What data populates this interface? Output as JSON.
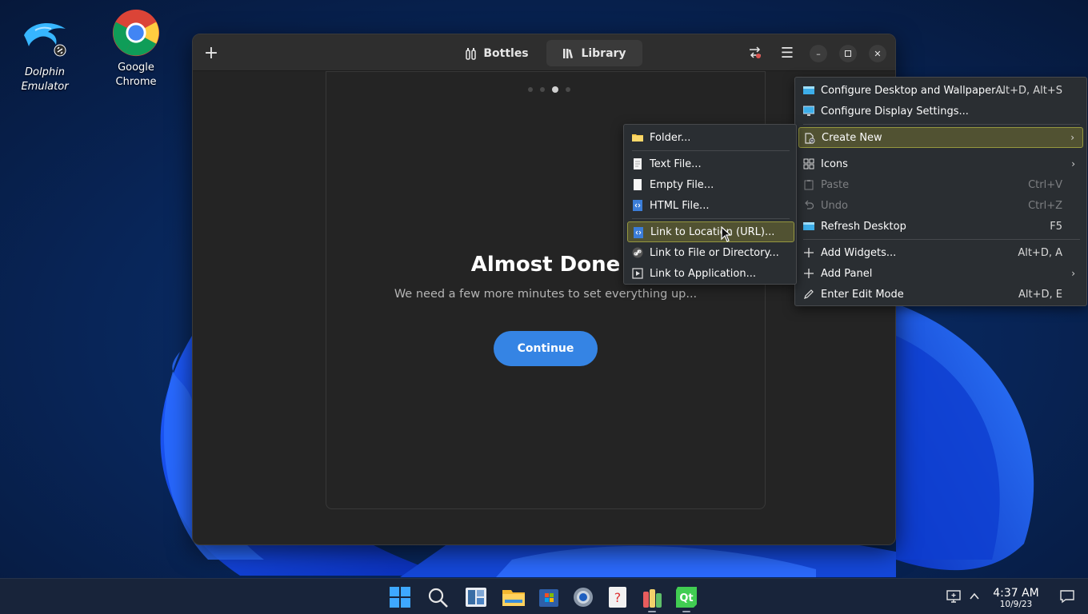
{
  "desktop": {
    "icons": [
      {
        "name": "Dolphin Emulator",
        "line1": "Dolphin",
        "line2": "Emulator",
        "icon": "dolphin-icon"
      },
      {
        "name": "Google Chrome",
        "line1": "Google Chrome",
        "icon": "chrome-icon"
      }
    ]
  },
  "app": {
    "tabs": [
      {
        "label": "Bottles",
        "icon": "bottles-icon"
      },
      {
        "label": "Library",
        "icon": "library-icon",
        "active": true
      }
    ],
    "onboarding": {
      "title": "Almost Done",
      "subtitle": "We need a few more minutes to set everything up...",
      "continue_label": "Continue",
      "page": 3,
      "page_count": 4
    }
  },
  "desktop_menu": {
    "items": [
      {
        "label": "Configure Desktop and Wallpaper...",
        "shortcut": "Alt+D, Alt+S",
        "icon": "wallpaper-icon"
      },
      {
        "label": "Configure Display Settings...",
        "shortcut": "",
        "icon": "display-icon"
      },
      {
        "label": "Create New",
        "shortcut": "",
        "icon": "create-new-icon",
        "submenu": true,
        "highlighted": true
      },
      {
        "label": "Icons",
        "shortcut": "",
        "icon": "grid-icon",
        "submenu": true
      },
      {
        "label": "Paste",
        "shortcut": "Ctrl+V",
        "icon": "paste-icon",
        "disabled": true
      },
      {
        "label": "Undo",
        "shortcut": "Ctrl+Z",
        "icon": "undo-icon",
        "disabled": true
      },
      {
        "label": "Refresh Desktop",
        "shortcut": "F5",
        "icon": "refresh-icon"
      },
      {
        "label": "Add Widgets...",
        "shortcut": "Alt+D, A",
        "icon": "plus-icon"
      },
      {
        "label": "Add Panel",
        "shortcut": "",
        "icon": "plus-icon",
        "submenu": true
      },
      {
        "label": "Enter Edit Mode",
        "shortcut": "Alt+D, E",
        "icon": "pencil-icon"
      }
    ]
  },
  "create_new_menu": {
    "items": [
      {
        "label": "Folder...",
        "icon": "folder-icon"
      },
      {
        "label": "Text File...",
        "icon": "text-file-icon"
      },
      {
        "label": "Empty File...",
        "icon": "empty-file-icon"
      },
      {
        "label": "HTML File...",
        "icon": "html-file-icon"
      },
      {
        "label": "Link to Location (URL)...",
        "icon": "url-link-icon",
        "highlighted": true
      },
      {
        "label": "Link to File or Directory...",
        "icon": "link-icon"
      },
      {
        "label": "Link to Application...",
        "icon": "app-link-icon"
      }
    ]
  },
  "taskbar": {
    "apps": [
      "start-icon",
      "search-icon",
      "widgets-icon",
      "file-explorer-icon",
      "store-icon",
      "settings-icon",
      "help-icon",
      "bottles-app-icon",
      "qt-icon"
    ],
    "time": "4:37 AM",
    "date": "10/9/23"
  },
  "colors": {
    "accent": "#3584e4",
    "menu_highlight": "#515232",
    "menu_bg": "#2a2e32",
    "window_bg": "#242424"
  }
}
